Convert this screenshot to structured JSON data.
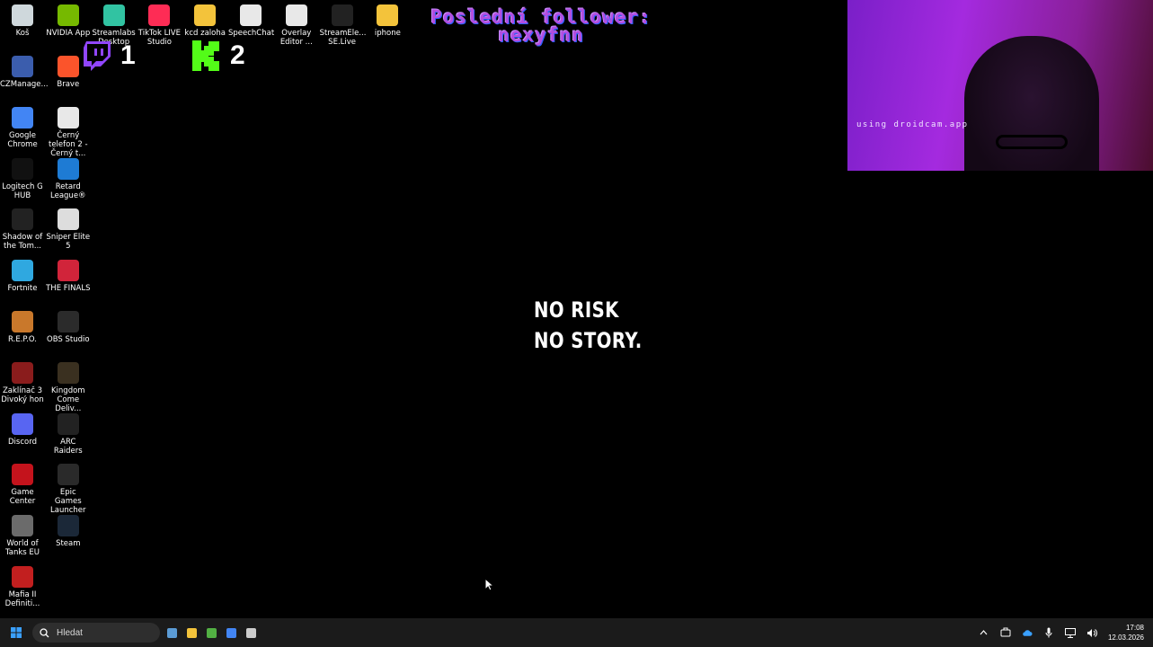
{
  "desktop_icons": [
    {
      "label": "Koš",
      "icon": "recycle-bin-icon",
      "color": "#cfd8dc"
    },
    {
      "label": "NVIDIA App",
      "icon": "nvidia-icon",
      "color": "#76b900"
    },
    {
      "label": "Streamlabs Desktop",
      "icon": "streamlabs-icon",
      "color": "#31c3a2"
    },
    {
      "label": "TikTok LIVE Studio",
      "icon": "tiktok-icon",
      "color": "#fe2c55"
    },
    {
      "label": "kcd zaloha",
      "icon": "folder-icon",
      "color": "#f3c33b"
    },
    {
      "label": "SpeechChat",
      "icon": "chrome-icon",
      "color": "#e8e8e8"
    },
    {
      "label": "Overlay Editor ...",
      "icon": "chrome-icon",
      "color": "#e8e8e8"
    },
    {
      "label": "StreamEle... SE.Live",
      "icon": "streamelements-icon",
      "color": "#222222"
    },
    {
      "label": "iphone",
      "icon": "folder-icon",
      "color": "#f3c33b"
    },
    {
      "label": "CZManage...",
      "icon": "czmanager-icon",
      "color": "#3b5dad"
    },
    {
      "label": "Brave",
      "icon": "brave-icon",
      "color": "#fb542b"
    },
    {
      "label": "Google Chrome",
      "icon": "chrome-icon",
      "color": "#4285f4"
    },
    {
      "label": "Černý telefon 2 - Černý t...",
      "icon": "chrome-icon",
      "color": "#e8e8e8"
    },
    {
      "label": "Logitech G HUB",
      "icon": "logitech-icon",
      "color": "#111111"
    },
    {
      "label": "Retard League®",
      "icon": "rocket-league-icon",
      "color": "#1e7bd4"
    },
    {
      "label": "Shadow of the Tom...",
      "icon": "shadow-tomb-raider-icon",
      "color": "#222222"
    },
    {
      "label": "Sniper Elite 5",
      "icon": "sniper-elite-icon",
      "color": "#dddddd"
    },
    {
      "label": "Fortnite",
      "icon": "fortnite-icon",
      "color": "#2fa8e0"
    },
    {
      "label": "THE FINALS",
      "icon": "the-finals-icon",
      "color": "#d1243a"
    },
    {
      "label": "R.E.P.O.",
      "icon": "repo-icon",
      "color": "#c9782b"
    },
    {
      "label": "OBS Studio",
      "icon": "obs-icon",
      "color": "#2b2b2b"
    },
    {
      "label": "Zaklínač 3 Divoký hon",
      "icon": "witcher-icon",
      "color": "#8a1c1c"
    },
    {
      "label": "Kingdom Come Deliv...",
      "icon": "kingdom-come-icon",
      "color": "#3a3020"
    },
    {
      "label": "Discord",
      "icon": "discord-icon",
      "color": "#5865f2"
    },
    {
      "label": "ARC Raiders",
      "icon": "arc-raiders-icon",
      "color": "#222222"
    },
    {
      "label": "Game Center",
      "icon": "game-center-icon",
      "color": "#c4131c"
    },
    {
      "label": "Epic Games Launcher",
      "icon": "epic-games-icon",
      "color": "#2a2a2a"
    },
    {
      "label": "World of Tanks EU",
      "icon": "world-of-tanks-icon",
      "color": "#6b6b6b"
    },
    {
      "label": "Steam",
      "icon": "steam-icon",
      "color": "#1b2838"
    },
    {
      "label": "Mafia II Definiti...",
      "icon": "mafia-icon",
      "color": "#c21f1f"
    }
  ],
  "overlay": {
    "follower_title": "Poslední follower:",
    "follower_name": "nexyfnn",
    "twitch_count": "1",
    "kick_count": "2",
    "twitch_color": "#9146ff",
    "kick_color": "#53fc18"
  },
  "webcam": {
    "watermark": "using droidcam.app"
  },
  "motto": {
    "line1": "NO RISK",
    "line2": "NO STORY."
  },
  "taskbar": {
    "search_placeholder": "Hledat",
    "apps": [
      {
        "icon": "calendar-app-icon",
        "color": "#5b9bd5"
      },
      {
        "icon": "file-explorer-icon",
        "color": "#f3c33b"
      },
      {
        "icon": "xbox-icon",
        "color": "#52b043"
      },
      {
        "icon": "chrome-icon",
        "color": "#4285f4"
      },
      {
        "icon": "settings-icon",
        "color": "#cccccc"
      }
    ],
    "clock_time": "17:08",
    "clock_date": "12.03.2026"
  }
}
